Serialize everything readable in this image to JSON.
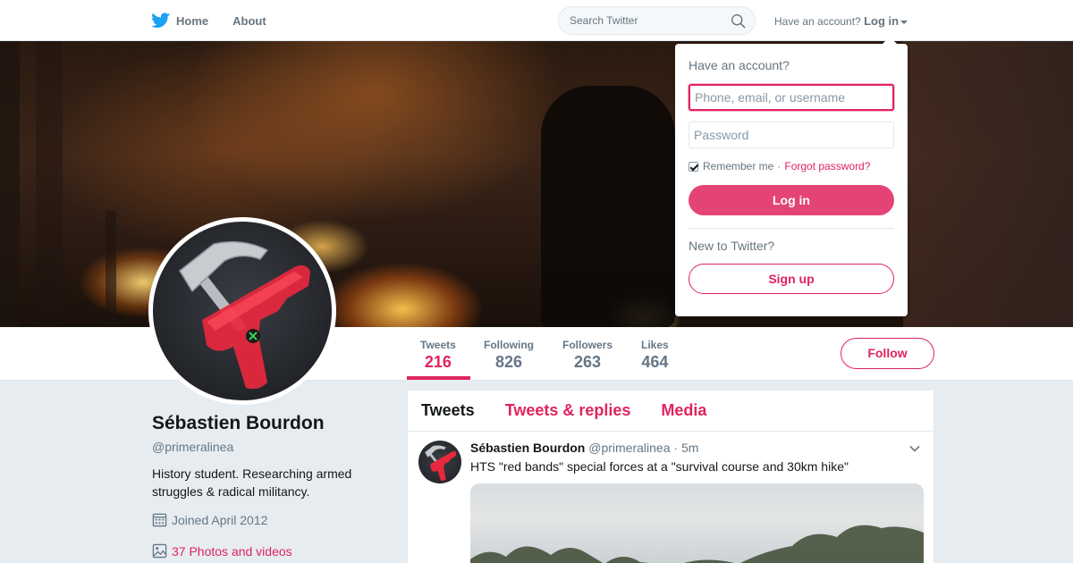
{
  "nav": {
    "home_label": "Home",
    "about_label": "About",
    "search_placeholder": "Search Twitter",
    "have_account_text": "Have an account?",
    "login_label": "Log in"
  },
  "login_dropdown": {
    "title": "Have an account?",
    "username_placeholder": "Phone, email, or username",
    "password_placeholder": "Password",
    "remember_label": "Remember me",
    "separator": "·",
    "forgot_label": "Forgot password?",
    "remember_checked": true,
    "login_button": "Log in",
    "new_text": "New to Twitter?",
    "signup_button": "Sign up"
  },
  "stats": [
    {
      "label": "Tweets",
      "value": "216"
    },
    {
      "label": "Following",
      "value": "826"
    },
    {
      "label": "Followers",
      "value": "263"
    },
    {
      "label": "Likes",
      "value": "464"
    }
  ],
  "follow_button": "Follow",
  "profile": {
    "name": "Sébastien Bourdon",
    "handle": "@primeralinea",
    "bio": "History student. Researching armed struggles & radical militancy.",
    "joined": "Joined April 2012",
    "photos": "37 Photos and videos"
  },
  "timeline": {
    "tabs": [
      "Tweets",
      "Tweets & replies",
      "Media"
    ],
    "tweet": {
      "name": "Sébastien Bourdon",
      "handle": "@primeralinea",
      "dot": "·",
      "time": "5m",
      "text": "HTS \"red bands\" special forces at a \"survival course and 30km hike\""
    }
  },
  "colors": {
    "accent": "#e0245e",
    "twitter_blue": "#1da1f2",
    "muted": "#657786"
  },
  "icons": [
    "twitter-bird-icon",
    "search-icon",
    "caret-down-icon",
    "calendar-icon",
    "photo-icon",
    "chevron-down-icon"
  ]
}
